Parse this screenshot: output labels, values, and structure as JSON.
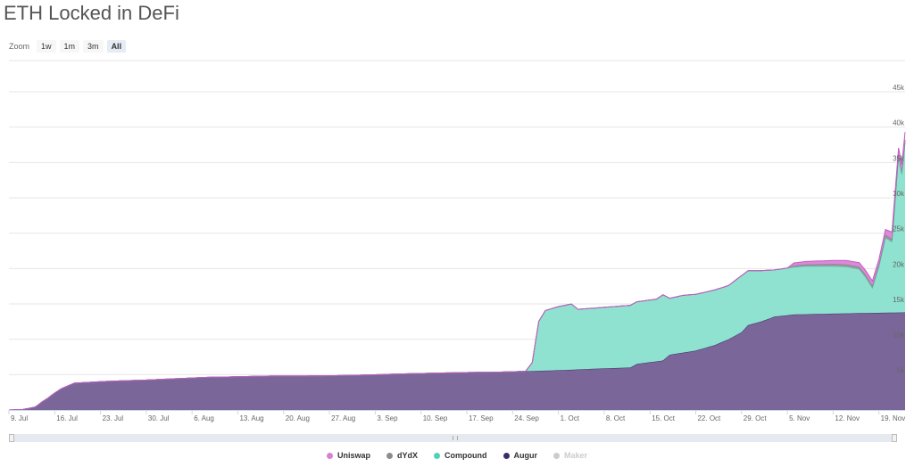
{
  "title": "ETH Locked in DeFi",
  "zoom": {
    "label": "Zoom",
    "buttons": [
      "1w",
      "1m",
      "3m",
      "All"
    ],
    "active": "All"
  },
  "colors": {
    "uniswap": "#d681d6",
    "dydx": "#8c8c8c",
    "compound": "#7fdfc9",
    "augur": "#6a5490",
    "maker": "#cccccc",
    "grid": "#e6e6e6",
    "axis": "#ccd6eb"
  },
  "legend": [
    {
      "name": "Uniswap",
      "color": "#d681d6",
      "hidden": false
    },
    {
      "name": "dYdX",
      "color": "#8c8c8c",
      "hidden": false
    },
    {
      "name": "Compound",
      "color": "#4fd3b8",
      "hidden": false
    },
    {
      "name": "Augur",
      "color": "#3d2c6b",
      "hidden": false
    },
    {
      "name": "Maker",
      "color": "#cccccc",
      "hidden": true
    }
  ],
  "chart_data": {
    "type": "area",
    "stacked": true,
    "title": "ETH Locked in DeFi",
    "x_tick_labels": [
      "9. Jul",
      "16. Jul",
      "23. Jul",
      "30. Jul",
      "6. Aug",
      "13. Aug",
      "20. Aug",
      "27. Aug",
      "3. Sep",
      "10. Sep",
      "17. Sep",
      "24. Sep",
      "1. Oct",
      "8. Oct",
      "15. Oct",
      "22. Oct",
      "29. Oct",
      "5. Nov",
      "12. Nov",
      "19. Nov"
    ],
    "y_tick_labels": [
      "5k",
      "10k",
      "15k",
      "20k",
      "25k",
      "30k",
      "35k",
      "40k",
      "45k"
    ],
    "ylim": [
      0,
      45000
    ],
    "y_axis_side": "right",
    "legend_position": "bottom",
    "x_unit": "day index from 9. Jul",
    "series": [
      {
        "name": "Augur",
        "points": [
          [
            0,
            0
          ],
          [
            2,
            50
          ],
          [
            4,
            400
          ],
          [
            5,
            1100
          ],
          [
            6,
            1700
          ],
          [
            7,
            2400
          ],
          [
            8,
            3000
          ],
          [
            9,
            3400
          ],
          [
            10,
            3800
          ],
          [
            12,
            3900
          ],
          [
            15,
            4050
          ],
          [
            20,
            4200
          ],
          [
            25,
            4400
          ],
          [
            30,
            4600
          ],
          [
            35,
            4700
          ],
          [
            40,
            4800
          ],
          [
            45,
            4800
          ],
          [
            50,
            4850
          ],
          [
            55,
            4950
          ],
          [
            60,
            5100
          ],
          [
            65,
            5200
          ],
          [
            70,
            5300
          ],
          [
            75,
            5350
          ],
          [
            80,
            5500
          ],
          [
            85,
            5650
          ],
          [
            90,
            5850
          ],
          [
            95,
            6000
          ],
          [
            96,
            6500
          ],
          [
            100,
            7000
          ],
          [
            101,
            7800
          ],
          [
            105,
            8400
          ],
          [
            108,
            9200
          ],
          [
            110,
            10000
          ],
          [
            112,
            11000
          ],
          [
            113,
            12000
          ],
          [
            115,
            12500
          ],
          [
            117,
            13200
          ],
          [
            120,
            13500
          ],
          [
            125,
            13600
          ],
          [
            130,
            13700
          ],
          [
            137,
            13800
          ]
        ]
      },
      {
        "name": "Compound",
        "points": [
          [
            0,
            0
          ],
          [
            79,
            0
          ],
          [
            80,
            1200
          ],
          [
            81,
            7000
          ],
          [
            82,
            8500
          ],
          [
            84,
            9000
          ],
          [
            86,
            9300
          ],
          [
            87,
            8500
          ],
          [
            90,
            8600
          ],
          [
            95,
            8800
          ],
          [
            99,
            8800
          ],
          [
            100,
            9300
          ],
          [
            101,
            8000
          ],
          [
            103,
            8100
          ],
          [
            106,
            7900
          ],
          [
            108,
            7800
          ],
          [
            110,
            7600
          ],
          [
            112,
            8000
          ],
          [
            113,
            7700
          ],
          [
            115,
            7200
          ],
          [
            117,
            6600
          ],
          [
            120,
            6700
          ],
          [
            122,
            6800
          ],
          [
            126,
            6700
          ],
          [
            128,
            6600
          ],
          [
            130,
            6200
          ],
          [
            131,
            5000
          ],
          [
            132,
            3500
          ],
          [
            133,
            6500
          ],
          [
            134,
            10600
          ],
          [
            135,
            10000
          ],
          [
            135.5,
            16000
          ],
          [
            136,
            22000
          ],
          [
            136.5,
            19500
          ],
          [
            137,
            24000
          ]
        ]
      },
      {
        "name": "dYdX",
        "points": [
          [
            0,
            0
          ],
          [
            119,
            0
          ],
          [
            120,
            200
          ],
          [
            126,
            300
          ],
          [
            132,
            350
          ],
          [
            137,
            400
          ]
        ]
      },
      {
        "name": "Uniswap",
        "points": [
          [
            0,
            0
          ],
          [
            119,
            0
          ],
          [
            120,
            400
          ],
          [
            125,
            500
          ],
          [
            130,
            600
          ],
          [
            133,
            700
          ],
          [
            134,
            800
          ],
          [
            135,
            1000
          ],
          [
            136,
            900
          ],
          [
            137,
            1100
          ]
        ]
      }
    ]
  }
}
